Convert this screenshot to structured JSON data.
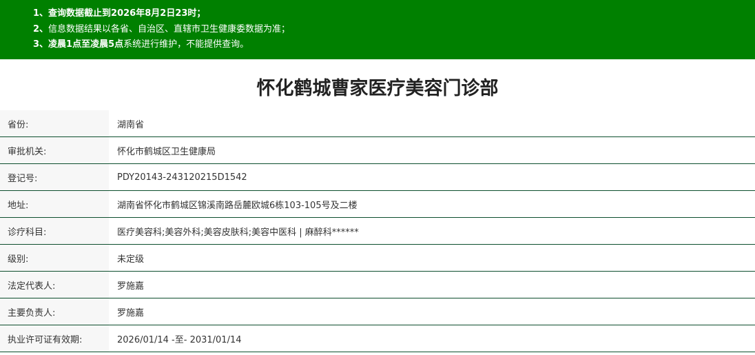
{
  "notice": {
    "line1": {
      "prefix": "1、",
      "text": "查询数据截止到2026年8月2日23时；"
    },
    "line2": {
      "prefix": "2、",
      "text": "信息数据结果以各省、自治区、直辖市卫生健康委数据为准；"
    },
    "line3": {
      "prefix": "3、",
      "bold": "凌晨1点至凌晨5点",
      "text": "系统进行维护，不能提供查询。"
    }
  },
  "title": "怀化鹤城曹家医疗美容门诊部",
  "rows": [
    {
      "label": "省份:",
      "value": "湖南省"
    },
    {
      "label": "审批机关:",
      "value": "怀化市鹤城区卫生健康局"
    },
    {
      "label": "登记号:",
      "value": "PDY20143-243120215D1542"
    },
    {
      "label": "地址:",
      "value": "湖南省怀化市鹤城区锦溪南路岳麓欧城6栋103-105号及二楼"
    },
    {
      "label": "诊疗科目:",
      "value": "医疗美容科;美容外科;美容皮肤科;美容中医科 | 麻醉科******"
    },
    {
      "label": "级别:",
      "value": "未定级"
    },
    {
      "label": "法定代表人:",
      "value": "罗施嘉"
    },
    {
      "label": "主要负责人:",
      "value": "罗施嘉"
    },
    {
      "label": "执业许可证有效期:",
      "value": "2026/01/14 -至- 2031/01/14"
    }
  ],
  "colors": {
    "notice_bg": "#008000",
    "row_border": "#0b4d2c",
    "label_bg": "#f7f7f7"
  }
}
